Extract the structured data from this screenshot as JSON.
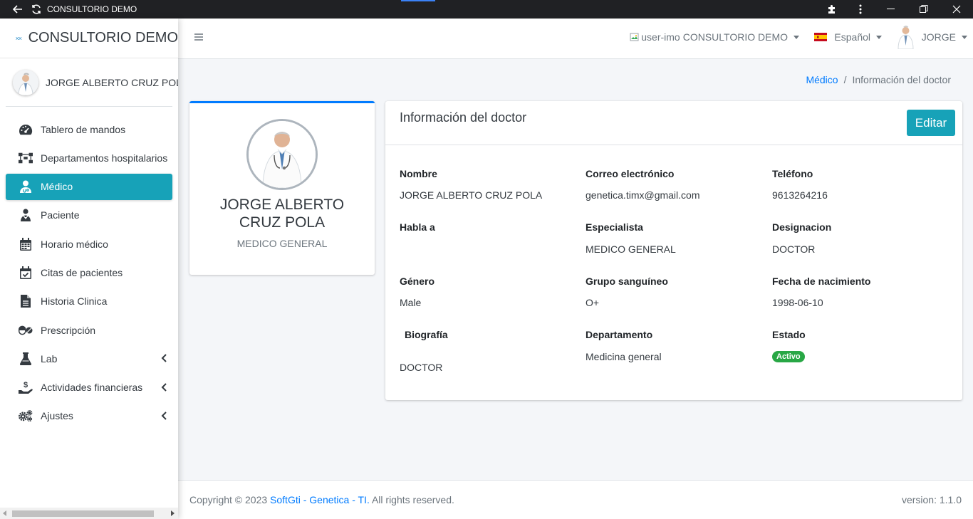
{
  "window": {
    "title": "CONSULTORIO DEMO"
  },
  "brand": {
    "name": "CONSULTORIO DEMO"
  },
  "user_panel": {
    "name": "JORGE ALBERTO CRUZ POLA"
  },
  "sidebar": {
    "items": [
      {
        "label": "Tablero de mandos",
        "icon": "dashboard-icon"
      },
      {
        "label": "Departamentos hospitalarios",
        "icon": "departments-icon"
      },
      {
        "label": "Médico",
        "icon": "doctor-icon",
        "active": true
      },
      {
        "label": "Paciente",
        "icon": "patient-icon"
      },
      {
        "label": "Horario médico",
        "icon": "calendar-icon"
      },
      {
        "label": "Citas de pacientes",
        "icon": "calendar-check-icon"
      },
      {
        "label": "Historia Clinica",
        "icon": "file-icon"
      },
      {
        "label": "Prescripción",
        "icon": "pills-icon"
      },
      {
        "label": "Lab",
        "icon": "flask-icon",
        "submenu": true
      },
      {
        "label": "Actividades financieras",
        "icon": "hand-money-icon",
        "submenu": true
      },
      {
        "label": "Ajustes",
        "icon": "gears-icon",
        "submenu": true
      }
    ]
  },
  "topnav": {
    "clinic_selector": {
      "alt": "user-imo",
      "label": "CONSULTORIO DEMO"
    },
    "language": {
      "label": "Español"
    },
    "user": {
      "label": "JORGE"
    }
  },
  "breadcrumb": {
    "parent": "Médico",
    "separator": "/",
    "current": "Información del doctor"
  },
  "profile": {
    "name": "JORGE ALBERTO CRUZ POLA",
    "role": "MEDICO GENERAL"
  },
  "info": {
    "title": "Información del doctor",
    "edit_label": "Editar",
    "fields": {
      "nombre": {
        "label": "Nombre",
        "value": "JORGE ALBERTO CRUZ POLA"
      },
      "correo": {
        "label": "Correo electrónico",
        "value": "genetica.timx@gmail.com"
      },
      "telefono": {
        "label": "Teléfono",
        "value": "9613264216"
      },
      "habla": {
        "label": "Habla a",
        "value": ""
      },
      "especialista": {
        "label": "Especialista",
        "value": "MEDICO GENERAL"
      },
      "designacion": {
        "label": "Designacion",
        "value": "DOCTOR"
      },
      "genero": {
        "label": "Género",
        "value": "Male"
      },
      "grupo": {
        "label": "Grupo sanguíneo",
        "value": "O+"
      },
      "nacimiento": {
        "label": "Fecha de nacimiento",
        "value": "1998-06-10"
      },
      "biografia": {
        "label": "Biografía",
        "value": "DOCTOR"
      },
      "departamento": {
        "label": "Departamento",
        "value": "Medicina general"
      },
      "estado": {
        "label": "Estado",
        "value": "Activo"
      }
    }
  },
  "footer": {
    "copyright_prefix": "Copyright © 2023 ",
    "link": "SoftGti - Genetica - TI.",
    "suffix": " All rights reserved.",
    "version": "version: 1.1.0"
  },
  "colors": {
    "accent": "#17a2b8",
    "link": "#007bff",
    "success": "#28a745"
  }
}
